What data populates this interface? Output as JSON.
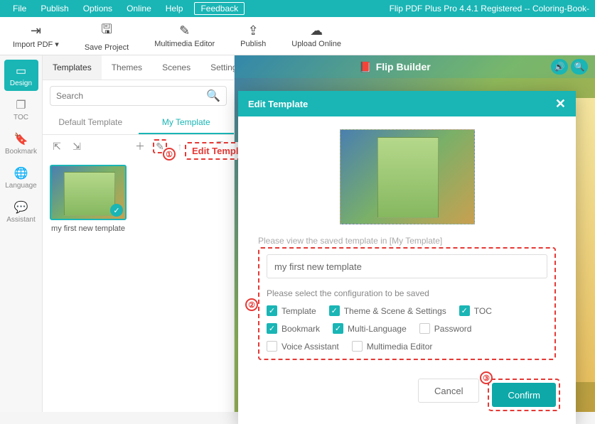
{
  "menubar": {
    "items": [
      "File",
      "Publish",
      "Options",
      "Online",
      "Help"
    ],
    "feedback": "Feedback",
    "title": "Flip PDF Plus Pro 4.4.1 Registered -- Coloring-Book-"
  },
  "toolbar": {
    "import": "Import PDF ▾",
    "save": "Save Project",
    "multimedia": "Multimedia Editor",
    "publish": "Publish",
    "upload": "Upload Online"
  },
  "sidenav": {
    "design": "Design",
    "toc": "TOC",
    "bookmark": "Bookmark",
    "language": "Language",
    "assistant": "Assistant"
  },
  "panel": {
    "tabs": [
      "Templates",
      "Themes",
      "Scenes",
      "Settings"
    ],
    "search_placeholder": "Search",
    "subtabs": {
      "default": "Default Template",
      "my": "My Template"
    },
    "template_name": "my first new template"
  },
  "callouts": {
    "edit_template": "Edit Template",
    "one": "①",
    "two": "②",
    "three": "③"
  },
  "preview": {
    "logo": "Flip Builder"
  },
  "modal": {
    "title": "Edit Template",
    "hint": "Please view the saved template in [My Template]",
    "input_value": "my first new template",
    "config_text": "Please select the configuration to be saved",
    "checks": [
      {
        "label": "Template",
        "checked": true
      },
      {
        "label": "Theme & Scene & Settings",
        "checked": true
      },
      {
        "label": "TOC",
        "checked": true
      },
      {
        "label": "Bookmark",
        "checked": true
      },
      {
        "label": "Multi-Language",
        "checked": true
      },
      {
        "label": "Password",
        "checked": false
      },
      {
        "label": "Voice Assistant",
        "checked": false
      },
      {
        "label": "Multimedia Editor",
        "checked": false
      }
    ],
    "cancel": "Cancel",
    "confirm": "Confirm"
  }
}
